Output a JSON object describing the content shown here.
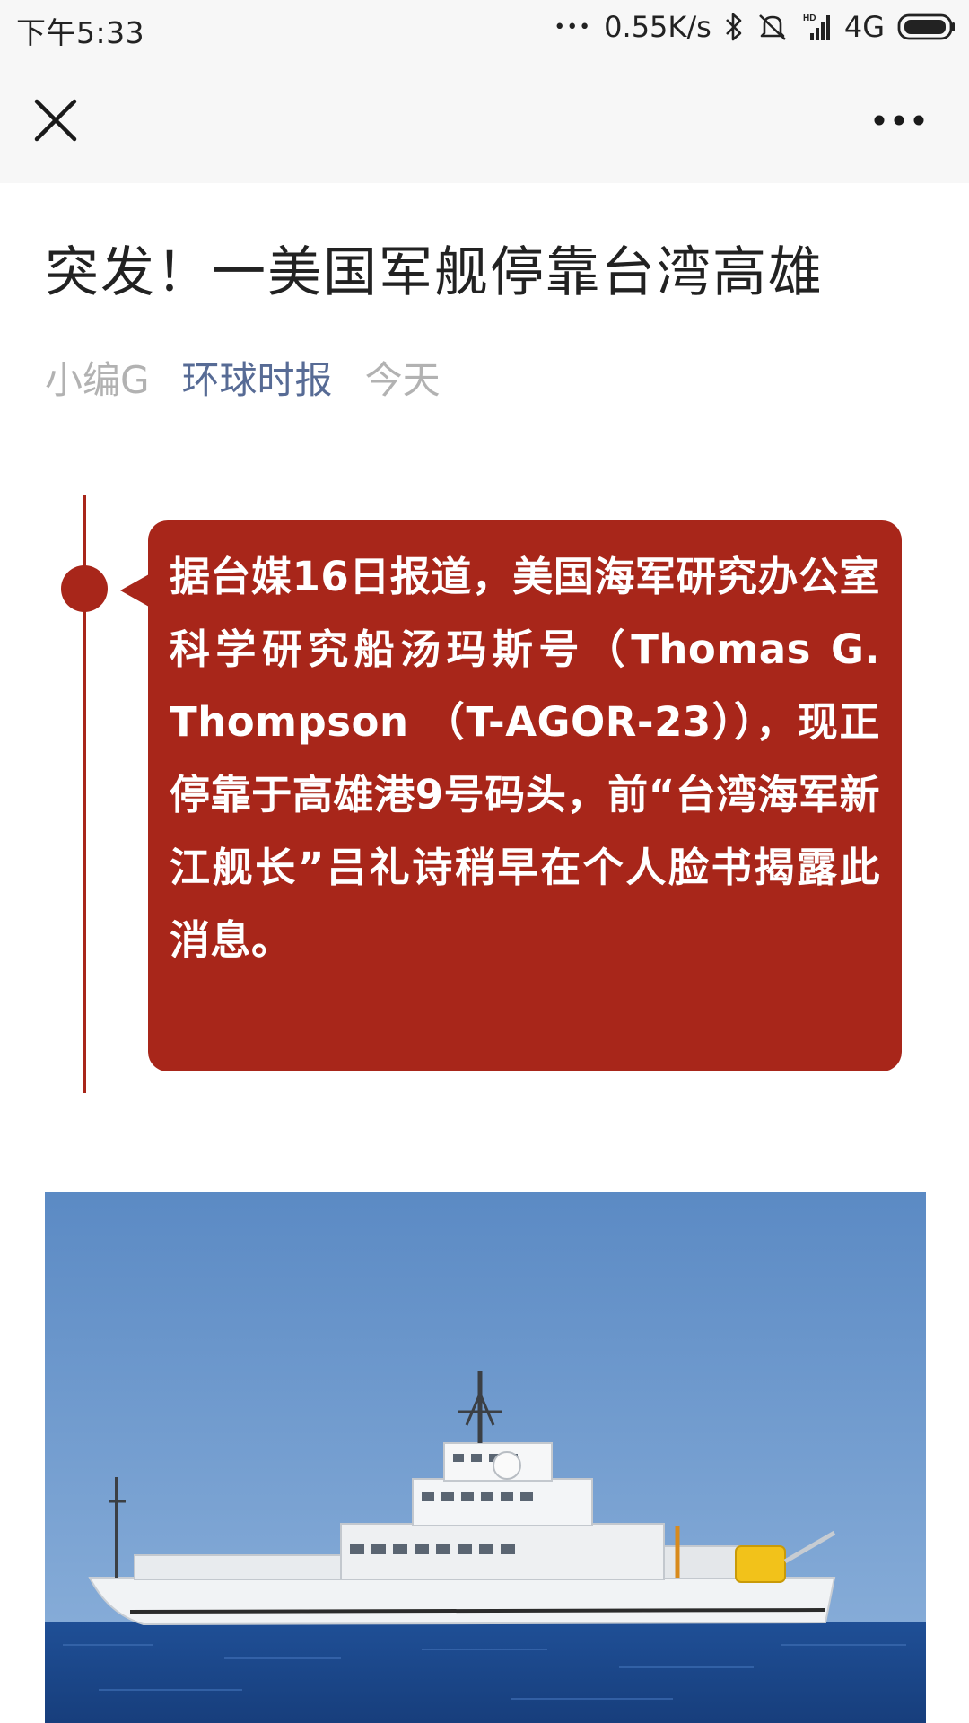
{
  "status_bar": {
    "time": "下午5:33",
    "dots": "•••",
    "network_speed": "0.55K/s",
    "network_type": "4G",
    "icons": [
      "bluetooth-icon",
      "mute-icon",
      "signal-hd-icon",
      "battery-icon"
    ]
  },
  "nav": {
    "close_icon": "close-icon",
    "more_icon": "more-dots-icon"
  },
  "article": {
    "title": "突发！一美国军舰停靠台湾高雄",
    "author": "小编G",
    "account": "环球时报",
    "date": "今天",
    "callout_text": "据台媒16日报道，美国海军研究办公室科学研究船汤玛斯号（Thomas G. Thompson （T-AGOR-23）），现正停靠于高雄港9号码头，前“台湾海军新江舰长”吕礼诗稍早在个人脸书揭露此消息。"
  },
  "colors": {
    "accent_red": "#a8261a",
    "link_blue": "#576b95",
    "meta_gray": "#b2b2b2",
    "bar_bg": "#f7f7f7"
  }
}
